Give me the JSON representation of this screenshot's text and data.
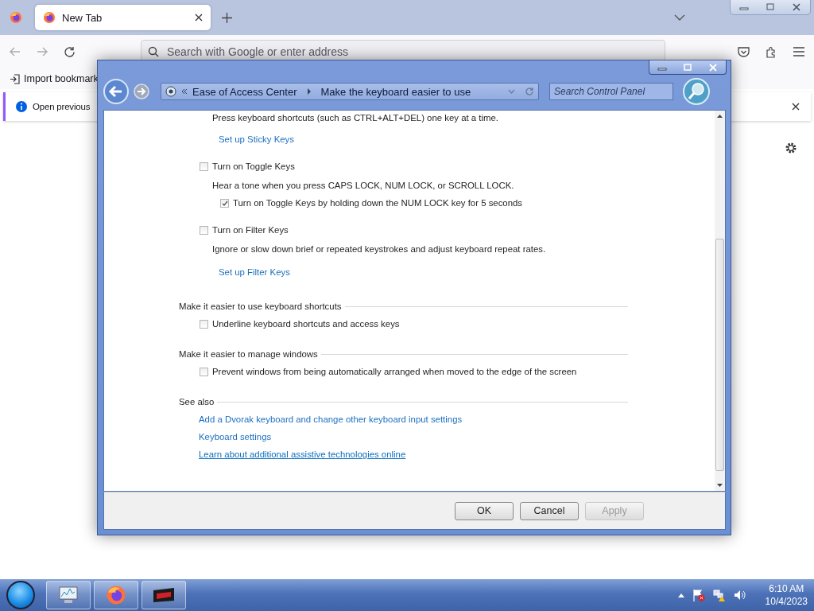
{
  "browser": {
    "tabs": [
      {
        "title": "New Tab",
        "selected": true
      }
    ],
    "address": {
      "placeholder": "Search with Google or enter address"
    },
    "bookmarks": [
      "Import bookmark"
    ],
    "notification": {
      "text": "Open previous"
    }
  },
  "dialog": {
    "breadcrumb": [
      "Ease of Access Center",
      "Make the keyboard easier to use"
    ],
    "search": {
      "placeholder": "Search Control Panel"
    },
    "options": [
      {
        "kind": "fragment",
        "description": "Press keyboard shortcuts (such as CTRL+ALT+DEL) one key at a time.",
        "link": "Set up Sticky Keys"
      },
      {
        "kind": "checkbox",
        "label": "Turn on Toggle Keys",
        "checked": false,
        "description": "Hear a tone when you press CAPS LOCK, NUM LOCK, or SCROLL LOCK.",
        "children": [
          {
            "kind": "checkbox",
            "label": "Turn on Toggle Keys by holding down the NUM LOCK key for 5 seconds",
            "checked": true
          }
        ]
      },
      {
        "kind": "checkbox",
        "label": "Turn on Filter Keys",
        "checked": false,
        "description": "Ignore or slow down brief or repeated keystrokes and adjust keyboard repeat rates.",
        "link": "Set up Filter Keys"
      }
    ],
    "groups": [
      {
        "heading": "Make it easier to use keyboard shortcuts",
        "items": [
          {
            "kind": "checkbox",
            "label": "Underline keyboard shortcuts and access keys",
            "checked": false
          }
        ]
      },
      {
        "heading": "Make it easier to manage windows",
        "items": [
          {
            "kind": "checkbox",
            "label": "Prevent windows from being automatically arranged when moved to the edge of the screen",
            "checked": false
          }
        ]
      },
      {
        "heading": "See also",
        "items": [
          {
            "kind": "link",
            "label": "Add a Dvorak keyboard and change other keyboard input settings",
            "hovered": false
          },
          {
            "kind": "link",
            "label": "Keyboard settings",
            "hovered": false
          },
          {
            "kind": "link",
            "label": "Learn about additional assistive technologies online",
            "hovered": true
          }
        ]
      }
    ],
    "buttons": [
      {
        "label": "OK",
        "disabled": false
      },
      {
        "label": "Cancel",
        "disabled": false
      },
      {
        "label": "Apply",
        "disabled": true
      }
    ]
  },
  "taskbar": {
    "time": "6:10 AM",
    "date": "10/4/2023"
  }
}
